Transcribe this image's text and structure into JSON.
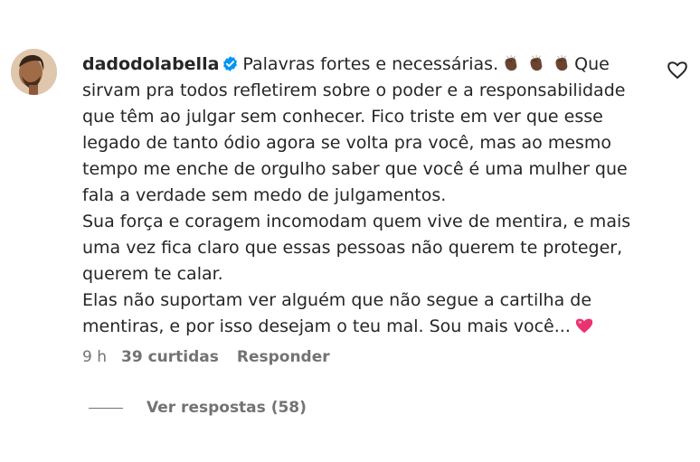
{
  "comment": {
    "username": "dadodolabella",
    "verified": true,
    "text_parts": [
      "Palavras fortes e necessárias.",
      "Que sirvam pra todos refletirem sobre o poder e a responsabilidade que têm ao julgar sem conhecer. Fico triste em ver que esse legado de tanto ódio agora se volta pra você, mas ao mesmo tempo me enche de orgulho saber que você é uma mulher que fala a verdade sem medo de julgamentos.",
      "Sua força e coragem incomodam quem vive de mentira, e mais uma vez fica claro que essas pessoas não querem te proteger, querem te calar.",
      "Elas não suportam ver alguém que não segue a cartilha de mentiras, e por isso desejam o teu mal. Sou mais você..."
    ],
    "emoji": {
      "clap": "clapping-hands-emoji",
      "heart": "pink-heart-emoji"
    },
    "time": "9 h",
    "likes": "39 curtidas",
    "reply_label": "Responder",
    "view_replies": "Ver respostas (58)"
  },
  "icons": {
    "verified": "verified-badge-icon",
    "like": "heart-outline-icon"
  },
  "colors": {
    "text": "#262626",
    "secondary": "#737373",
    "verified": "#0095f6",
    "heart_emoji": "#e8336f"
  }
}
